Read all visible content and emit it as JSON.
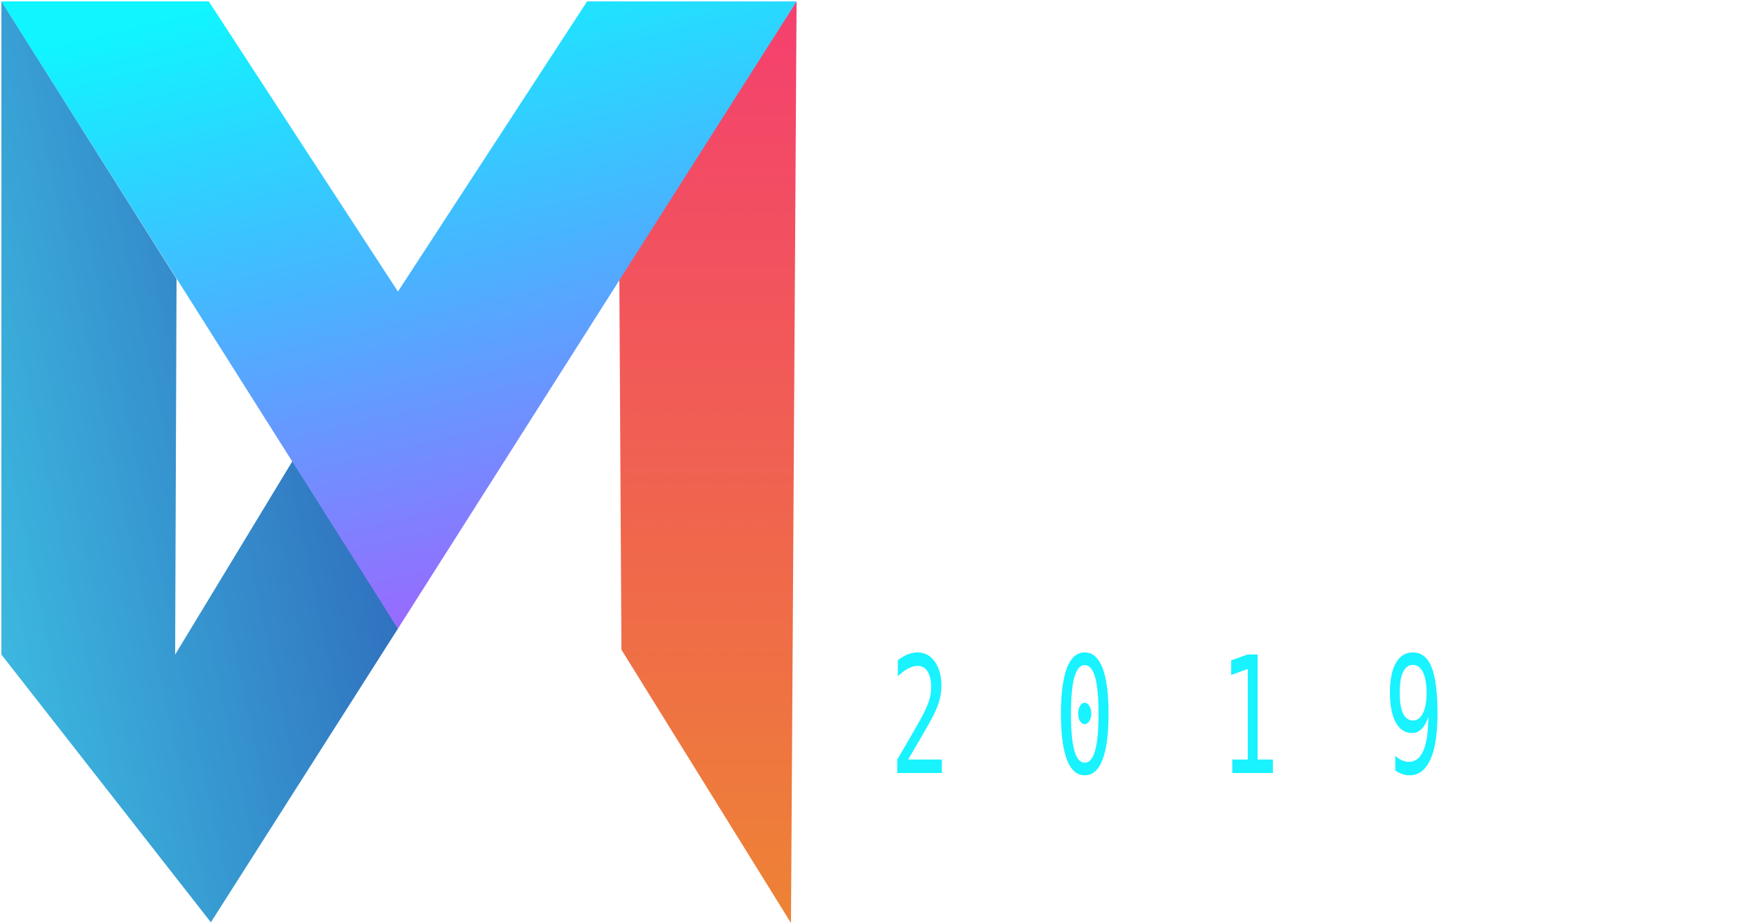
{
  "logo": {
    "icon": "m-logo-icon",
    "year": [
      "2",
      "0",
      "1",
      "9"
    ],
    "colors": {
      "cyan": "#12f4ff",
      "sky": "#3fb6ff",
      "violet": "#9b6bff",
      "navy": "#2f6cc0",
      "teal": "#3bb7df",
      "pink": "#f4406e",
      "orange": "#ec8236",
      "year": "#19f2ff"
    }
  }
}
